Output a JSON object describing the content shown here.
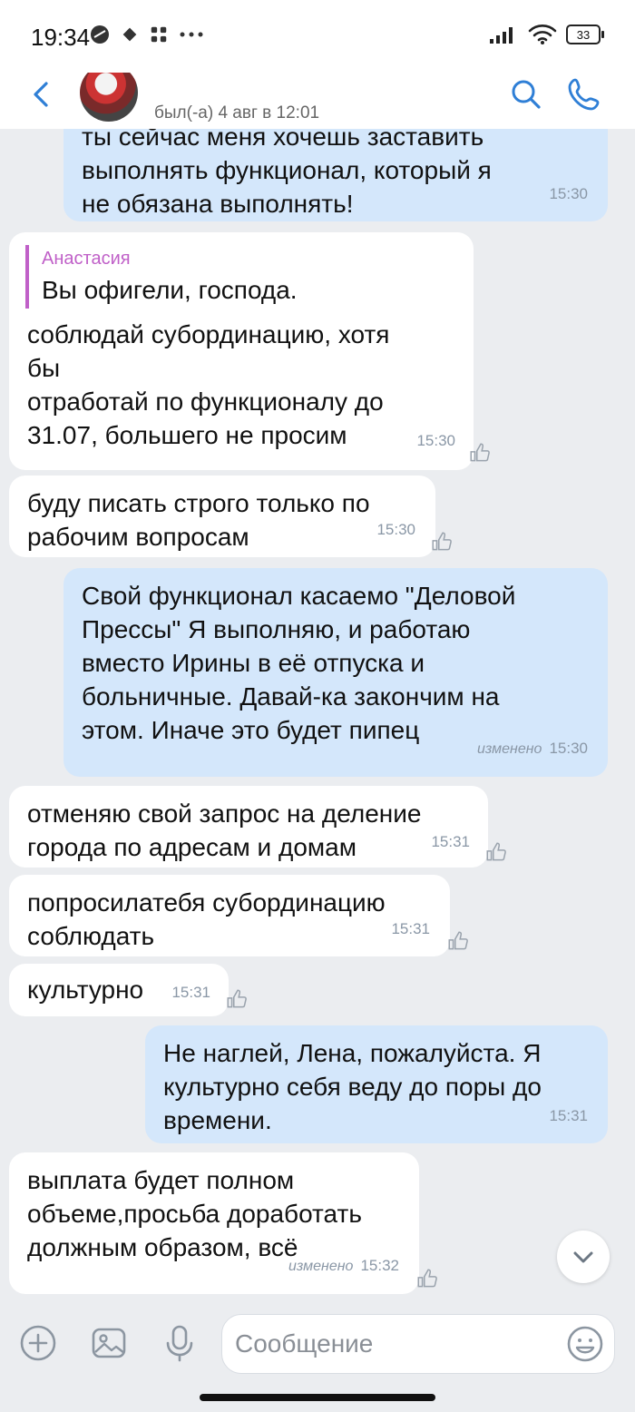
{
  "status": {
    "time": "19:34",
    "battery": "33"
  },
  "header": {
    "last_seen": "был(-а) 4 авг в 12:01"
  },
  "messages": [
    {
      "lines": [
        "ты сейчас меня хочешь заставить",
        "выполнять функционал, который я",
        "не обязана выполнять!"
      ],
      "time": "15:30"
    },
    {
      "reply_name": "Анастасия",
      "reply_text": "Вы офигели, господа.",
      "lines": [
        "соблюдай субординацию,  хотя",
        "бы",
        "отработай по функционалу до",
        "31.07, большего не просим"
      ],
      "time": "15:30"
    },
    {
      "lines": [
        "буду писать строго только по",
        "рабочим вопросам"
      ],
      "time": "15:30"
    },
    {
      "lines": [
        "Свой функционал касаемо \"Деловой",
        "Прессы\" Я выполняю, и работаю",
        "вместо Ирины в её отпуска и",
        "больничные. Давай-ка закончим на",
        "этом. Иначе это будет пипец"
      ],
      "edited": "изменено",
      "time": "15:30"
    },
    {
      "lines": [
        "отменяю свой запрос на деление",
        "города по адресам и домам"
      ],
      "time": "15:31"
    },
    {
      "lines": [
        "попросилатебя субординацию",
        "соблюдать"
      ],
      "time": "15:31"
    },
    {
      "lines": [
        "культурно"
      ],
      "time": "15:31"
    },
    {
      "lines": [
        "Не наглей, Лена, пожалуйста. Я",
        "культурно себя веду до поры до",
        "времени."
      ],
      "time": "15:31"
    },
    {
      "lines": [
        "выплата будет  полном",
        "объеме,просьба доработать",
        "должным образом, всё"
      ],
      "edited": "изменено",
      "time": "15:32"
    }
  ],
  "composer": {
    "placeholder": "Сообщение"
  }
}
